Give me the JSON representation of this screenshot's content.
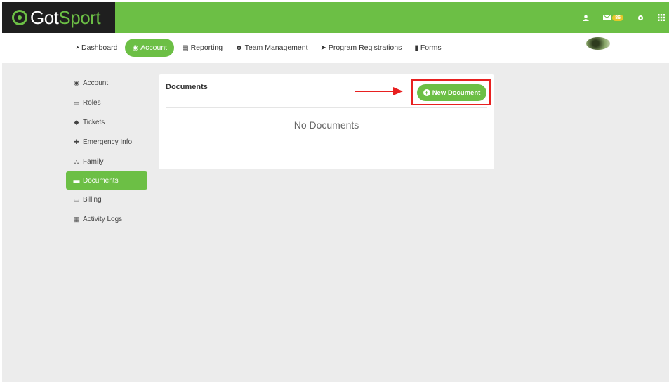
{
  "brand": {
    "part1": "Got",
    "part2": "Sport"
  },
  "topbar": {
    "mail_badge": "86"
  },
  "nav": [
    {
      "label": "Dashboard",
      "icon": "tachometer-icon",
      "glyph": "◔"
    },
    {
      "label": "Account",
      "icon": "user-circle-icon",
      "glyph": "◉",
      "active": true
    },
    {
      "label": "Reporting",
      "icon": "file-report-icon",
      "glyph": "▤"
    },
    {
      "label": "Team Management",
      "icon": "users-icon",
      "glyph": "☻"
    },
    {
      "label": "Program Registrations",
      "icon": "paper-plane-icon",
      "glyph": "➤"
    },
    {
      "label": "Forms",
      "icon": "file-icon",
      "glyph": "▮"
    }
  ],
  "sidebar": [
    {
      "label": "Account",
      "icon": "user-circle-icon",
      "glyph": "◉"
    },
    {
      "label": "Roles",
      "icon": "id-card-icon",
      "glyph": "▭"
    },
    {
      "label": "Tickets",
      "icon": "ticket-icon",
      "glyph": "◆"
    },
    {
      "label": "Emergency Info",
      "icon": "plus-square-icon",
      "glyph": "✚"
    },
    {
      "label": "Family",
      "icon": "sitemap-icon",
      "glyph": "⛬"
    },
    {
      "label": "Documents",
      "icon": "folder-open-icon",
      "glyph": "▬",
      "active": true
    },
    {
      "label": "Billing",
      "icon": "credit-card-icon",
      "glyph": "▭"
    },
    {
      "label": "Activity Logs",
      "icon": "archive-icon",
      "glyph": "▦"
    }
  ],
  "documents": {
    "title": "Documents",
    "new_button": "New Document",
    "empty_text": "No Documents"
  },
  "colors": {
    "brand_green": "#6cbf45",
    "highlight_red": "#e82020"
  }
}
